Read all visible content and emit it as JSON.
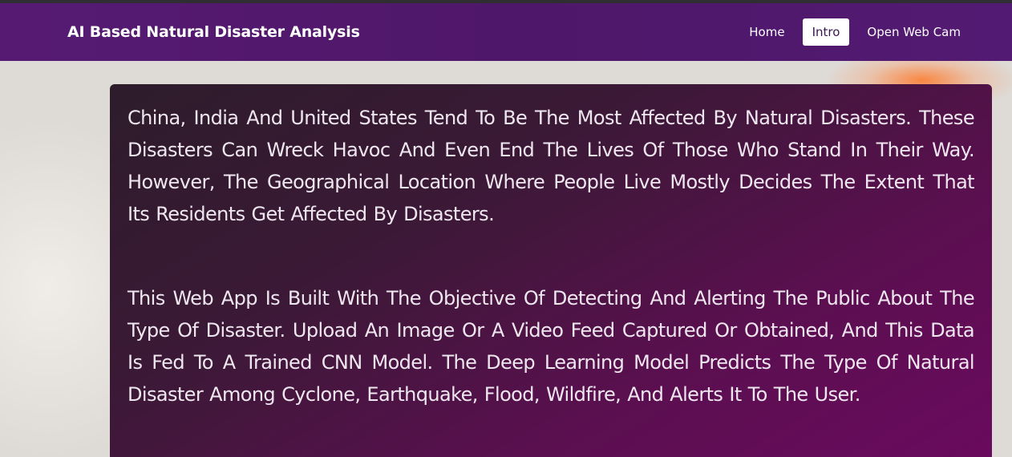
{
  "navbar": {
    "brand": "AI Based Natural Disaster Analysis",
    "items": [
      {
        "label": "Home",
        "active": false
      },
      {
        "label": "Intro",
        "active": true
      },
      {
        "label": "Open Web Cam",
        "active": false
      }
    ]
  },
  "content": {
    "paragraphs": [
      "China, India And United States Tend To Be The Most Affected By Natural Disasters. These Disasters Can Wreck Havoc And Even End The Lives Of Those Who Stand In Their Way. However, The Geographical Location Where People Live Mostly Decides The Extent That Its Residents Get Affected By Disasters.",
      "This Web App Is Built With The Objective Of Detecting And Alerting The Public About The Type Of Disaster. Upload An Image Or A Video Feed Captured Or Obtained, And This Data Is Fed To A Trained CNN Model. The Deep Learning Model Predicts The Type Of Natural Disaster Among Cyclone, Earthquake, Flood, Wildfire, And Alerts It To The User."
    ]
  },
  "colors": {
    "navbar": "#521a72",
    "card_start": "#2d1c2b",
    "card_end": "#6a0a5e",
    "accent_glow": "#ff7828"
  }
}
